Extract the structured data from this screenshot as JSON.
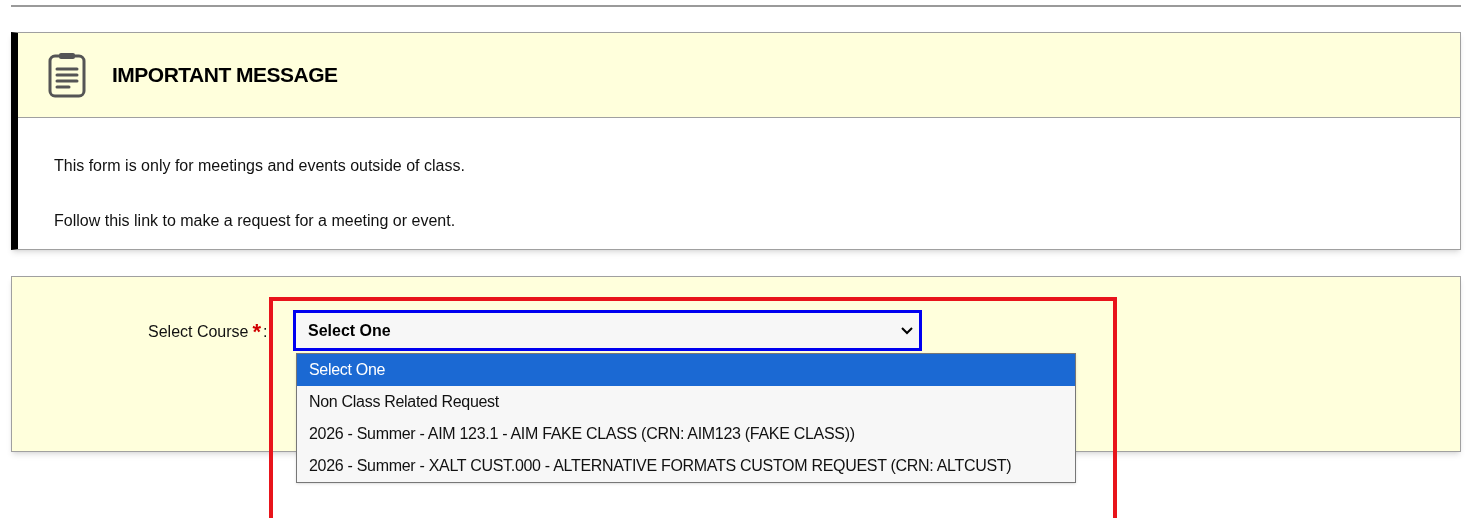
{
  "message": {
    "title": "IMPORTANT MESSAGE",
    "lines": [
      "This form is only for meetings and events outside of class.",
      "Follow this link to make a request for a meeting or event."
    ]
  },
  "form": {
    "label": "Select Course",
    "required_mark": "*",
    "colon": ":",
    "select": {
      "value": "Select One",
      "expanded": true,
      "options": [
        {
          "label": "Select One",
          "selected": true
        },
        {
          "label": "Non Class Related Request",
          "selected": false
        },
        {
          "label": "2026 - Summer - AIM 123.1 - AIM FAKE CLASS (CRN: AIM123 (FAKE CLASS))",
          "selected": false
        },
        {
          "label": "2026 - Summer - XALT CUST.000 - ALTERNATIVE FORMATS CUSTOM REQUEST (CRN: ALTCUST)",
          "selected": false
        }
      ]
    }
  }
}
